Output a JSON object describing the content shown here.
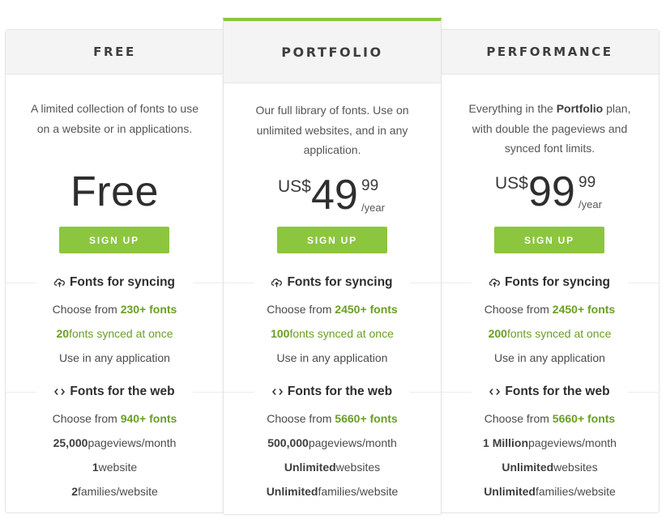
{
  "colors": {
    "accent": "#8cc63e",
    "highlight_text": "#6a9f24",
    "header_bg": "#f4f4f4"
  },
  "plans": [
    {
      "name": "FREE",
      "description": "A limited collection of fonts to use on a website or in applications.",
      "price": {
        "label": "Free"
      },
      "signup_label": "SIGN UP",
      "syncing": {
        "title": "Fonts for syncing",
        "icon": "cloud-sync-icon",
        "choose_prefix": "Choose from ",
        "choose_value": "230+ fonts",
        "synced_count": "20",
        "synced_text": " fonts synced at once",
        "usage": "Use in any application"
      },
      "web": {
        "title": "Fonts for the web",
        "icon": "code-icon",
        "choose_prefix": "Choose from ",
        "choose_value": "940+ fonts",
        "pageviews_value": "25,000",
        "pageviews_text": " pageviews/month",
        "websites_value": "1",
        "websites_text": " website",
        "families_value": "2",
        "families_text": " families/website"
      }
    },
    {
      "name": "PORTFOLIO",
      "description": "Our full library of fonts. Use on unlimited websites, and in any application.",
      "price": {
        "currency": "US$",
        "amount": "49",
        "cents": "99",
        "period": "/year"
      },
      "signup_label": "SIGN UP",
      "syncing": {
        "title": "Fonts for syncing",
        "icon": "cloud-sync-icon",
        "choose_prefix": "Choose from ",
        "choose_value": "2450+ fonts",
        "synced_count": "100",
        "synced_text": " fonts synced at once",
        "usage": "Use in any application"
      },
      "web": {
        "title": "Fonts for the web",
        "icon": "code-icon",
        "choose_prefix": "Choose from ",
        "choose_value": "5660+ fonts",
        "pageviews_value": "500,000",
        "pageviews_text": " pageviews/month",
        "websites_value": "Unlimited",
        "websites_text": " websites",
        "families_value": "Unlimited",
        "families_text": " families/website"
      }
    },
    {
      "name": "PERFORMANCE",
      "description_prefix": "Everything in the ",
      "description_bold": "Portfolio",
      "description_suffix": " plan, with double the pageviews and synced font limits.",
      "price": {
        "currency": "US$",
        "amount": "99",
        "cents": "99",
        "period": "/year"
      },
      "signup_label": "SIGN UP",
      "syncing": {
        "title": "Fonts for syncing",
        "icon": "cloud-sync-icon",
        "choose_prefix": "Choose from ",
        "choose_value": "2450+ fonts",
        "synced_count": "200",
        "synced_text": " fonts synced at once",
        "usage": "Use in any application"
      },
      "web": {
        "title": "Fonts for the web",
        "icon": "code-icon",
        "choose_prefix": "Choose from ",
        "choose_value": "5660+ fonts",
        "pageviews_value": "1 Million",
        "pageviews_text": " pageviews/month",
        "websites_value": "Unlimited",
        "websites_text": " websites",
        "families_value": "Unlimited",
        "families_text": " families/website"
      }
    }
  ]
}
